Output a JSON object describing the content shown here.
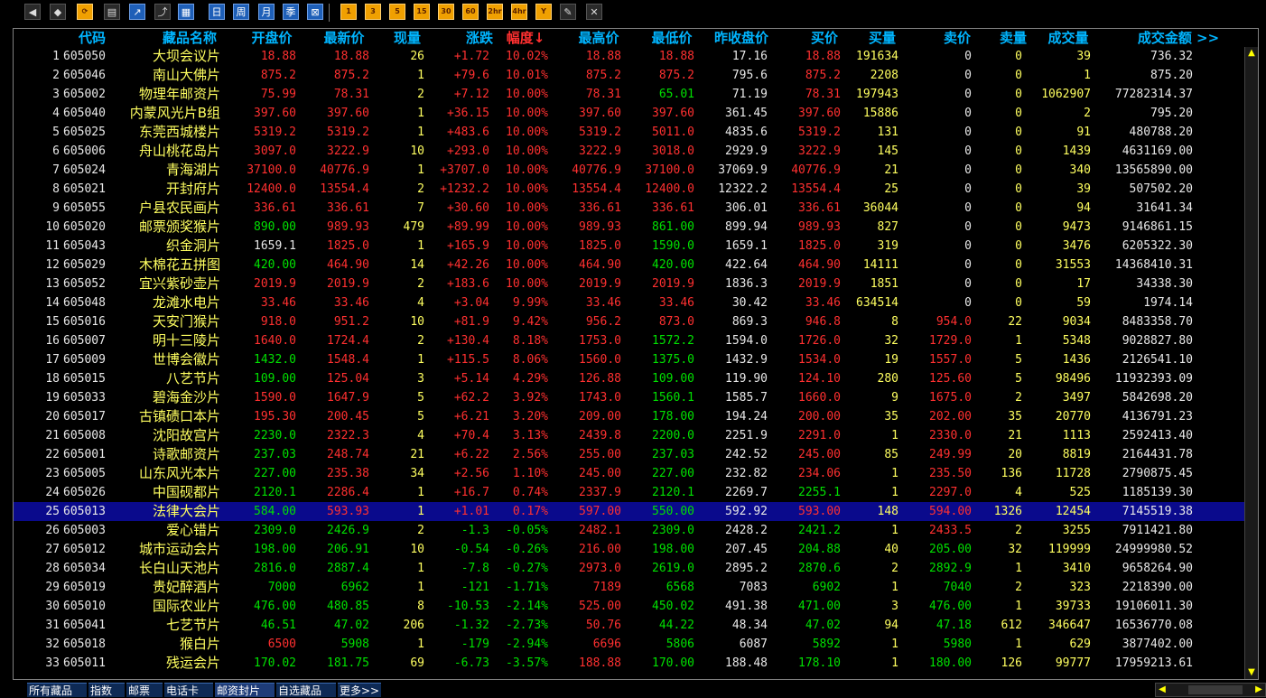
{
  "toolbar": {
    "buttons": [
      {
        "name": "back-icon",
        "glyph": "◀",
        "kind": "misc"
      },
      {
        "name": "box-icon",
        "glyph": "◆",
        "kind": "misc"
      },
      {
        "name": "refresh-icon",
        "glyph": "⟳",
        "kind": "orange"
      },
      {
        "name": "clipboard-icon",
        "glyph": "▤",
        "kind": "misc"
      },
      {
        "name": "line-chart-icon",
        "glyph": "↗",
        "kind": "blue"
      },
      {
        "name": "trend-chart-icon",
        "glyph": "⤴",
        "kind": "misc"
      },
      {
        "name": "table-icon",
        "glyph": "▦",
        "kind": "blue"
      },
      {
        "name": "day-button",
        "glyph": "日",
        "kind": "blue"
      },
      {
        "name": "week-button",
        "glyph": "周",
        "kind": "blue"
      },
      {
        "name": "month-button",
        "glyph": "月",
        "kind": "blue"
      },
      {
        "name": "quarter-button",
        "glyph": "季",
        "kind": "blue"
      },
      {
        "name": "crosshair-icon",
        "glyph": "⊠",
        "kind": "blue"
      },
      {
        "name": "period-1-button",
        "glyph": "1",
        "kind": "orange"
      },
      {
        "name": "period-3-button",
        "glyph": "3",
        "kind": "orange"
      },
      {
        "name": "period-5-button",
        "glyph": "5",
        "kind": "orange"
      },
      {
        "name": "period-15-button",
        "glyph": "15",
        "kind": "orange"
      },
      {
        "name": "period-30-button",
        "glyph": "30",
        "kind": "orange"
      },
      {
        "name": "period-60-button",
        "glyph": "60",
        "kind": "orange"
      },
      {
        "name": "period-2hr-button",
        "glyph": "2hr",
        "kind": "orange"
      },
      {
        "name": "period-4hr-button",
        "glyph": "4hr",
        "kind": "orange"
      },
      {
        "name": "year-button",
        "glyph": "Y",
        "kind": "orange"
      },
      {
        "name": "pencil-icon",
        "glyph": "✎",
        "kind": "misc"
      },
      {
        "name": "tools-icon",
        "glyph": "✕",
        "kind": "misc"
      }
    ]
  },
  "columns": [
    "代码",
    "藏品名称",
    "开盘价",
    "最新价",
    "现量",
    "涨跌",
    "幅度↓",
    "最高价",
    "最低价",
    "昨收盘价",
    "买价",
    "买量",
    "卖价",
    "卖量",
    "成交量",
    "成交金额 >>"
  ],
  "rows": [
    [
      "1",
      "605050",
      "大坝会议片",
      "18.88",
      "18.88",
      "26",
      "+1.72",
      "10.02%",
      "18.88",
      "18.88",
      "17.16",
      "18.88",
      "191634",
      "0",
      "0",
      "39",
      "736.32"
    ],
    [
      "2",
      "605046",
      "南山大佛片",
      "875.2",
      "875.2",
      "1",
      "+79.6",
      "10.01%",
      "875.2",
      "875.2",
      "795.6",
      "875.2",
      "2208",
      "0",
      "0",
      "1",
      "875.20"
    ],
    [
      "3",
      "605002",
      "物理年邮资片",
      "75.99",
      "78.31",
      "2",
      "+7.12",
      "10.00%",
      "78.31",
      "65.01",
      "71.19",
      "78.31",
      "197943",
      "0",
      "0",
      "1062907",
      "77282314.37"
    ],
    [
      "4",
      "605040",
      "内蒙风光片B组",
      "397.60",
      "397.60",
      "1",
      "+36.15",
      "10.00%",
      "397.60",
      "397.60",
      "361.45",
      "397.60",
      "15886",
      "0",
      "0",
      "2",
      "795.20"
    ],
    [
      "5",
      "605025",
      "东莞西城楼片",
      "5319.2",
      "5319.2",
      "1",
      "+483.6",
      "10.00%",
      "5319.2",
      "5011.0",
      "4835.6",
      "5319.2",
      "131",
      "0",
      "0",
      "91",
      "480788.20"
    ],
    [
      "6",
      "605006",
      "舟山桃花岛片",
      "3097.0",
      "3222.9",
      "10",
      "+293.0",
      "10.00%",
      "3222.9",
      "3018.0",
      "2929.9",
      "3222.9",
      "145",
      "0",
      "0",
      "1439",
      "4631169.00"
    ],
    [
      "7",
      "605024",
      "青海湖片",
      "37100.0",
      "40776.9",
      "1",
      "+3707.0",
      "10.00%",
      "40776.9",
      "37100.0",
      "37069.9",
      "40776.9",
      "21",
      "0",
      "0",
      "340",
      "13565890.00"
    ],
    [
      "8",
      "605021",
      "开封府片",
      "12400.0",
      "13554.4",
      "2",
      "+1232.2",
      "10.00%",
      "13554.4",
      "12400.0",
      "12322.2",
      "13554.4",
      "25",
      "0",
      "0",
      "39",
      "507502.20"
    ],
    [
      "9",
      "605055",
      "户县农民画片",
      "336.61",
      "336.61",
      "7",
      "+30.60",
      "10.00%",
      "336.61",
      "336.61",
      "306.01",
      "336.61",
      "36044",
      "0",
      "0",
      "94",
      "31641.34"
    ],
    [
      "10",
      "605020",
      "邮票颁奖猴片",
      "890.00",
      "989.93",
      "479",
      "+89.99",
      "10.00%",
      "989.93",
      "861.00",
      "899.94",
      "989.93",
      "827",
      "0",
      "0",
      "9473",
      "9146861.15"
    ],
    [
      "11",
      "605043",
      "织金洞片",
      "1659.1",
      "1825.0",
      "1",
      "+165.9",
      "10.00%",
      "1825.0",
      "1590.0",
      "1659.1",
      "1825.0",
      "319",
      "0",
      "0",
      "3476",
      "6205322.30"
    ],
    [
      "12",
      "605029",
      "木棉花五拼图",
      "420.00",
      "464.90",
      "14",
      "+42.26",
      "10.00%",
      "464.90",
      "420.00",
      "422.64",
      "464.90",
      "14111",
      "0",
      "0",
      "31553",
      "14368410.31"
    ],
    [
      "13",
      "605052",
      "宜兴紫砂壶片",
      "2019.9",
      "2019.9",
      "2",
      "+183.6",
      "10.00%",
      "2019.9",
      "2019.9",
      "1836.3",
      "2019.9",
      "1851",
      "0",
      "0",
      "17",
      "34338.30"
    ],
    [
      "14",
      "605048",
      "龙滩水电片",
      "33.46",
      "33.46",
      "4",
      "+3.04",
      "9.99%",
      "33.46",
      "33.46",
      "30.42",
      "33.46",
      "634514",
      "0",
      "0",
      "59",
      "1974.14"
    ],
    [
      "15",
      "605016",
      "天安门猴片",
      "918.0",
      "951.2",
      "10",
      "+81.9",
      "9.42%",
      "956.2",
      "873.0",
      "869.3",
      "946.8",
      "8",
      "954.0",
      "22",
      "9034",
      "8483358.70"
    ],
    [
      "16",
      "605007",
      "明十三陵片",
      "1640.0",
      "1724.4",
      "2",
      "+130.4",
      "8.18%",
      "1753.0",
      "1572.2",
      "1594.0",
      "1726.0",
      "32",
      "1729.0",
      "1",
      "5348",
      "9028827.80"
    ],
    [
      "17",
      "605009",
      "世博会徽片",
      "1432.0",
      "1548.4",
      "1",
      "+115.5",
      "8.06%",
      "1560.0",
      "1375.0",
      "1432.9",
      "1534.0",
      "19",
      "1557.0",
      "5",
      "1436",
      "2126541.10"
    ],
    [
      "18",
      "605015",
      "八艺节片",
      "109.00",
      "125.04",
      "3",
      "+5.14",
      "4.29%",
      "126.88",
      "109.00",
      "119.90",
      "124.10",
      "280",
      "125.60",
      "5",
      "98496",
      "11932393.09"
    ],
    [
      "19",
      "605033",
      "碧海金沙片",
      "1590.0",
      "1647.9",
      "5",
      "+62.2",
      "3.92%",
      "1743.0",
      "1560.1",
      "1585.7",
      "1660.0",
      "9",
      "1675.0",
      "2",
      "3497",
      "5842698.20"
    ],
    [
      "20",
      "605017",
      "古镇碛口本片",
      "195.30",
      "200.45",
      "5",
      "+6.21",
      "3.20%",
      "209.00",
      "178.00",
      "194.24",
      "200.00",
      "35",
      "202.00",
      "35",
      "20770",
      "4136791.23"
    ],
    [
      "21",
      "605008",
      "沈阳故宫片",
      "2230.0",
      "2322.3",
      "4",
      "+70.4",
      "3.13%",
      "2439.8",
      "2200.0",
      "2251.9",
      "2291.0",
      "1",
      "2330.0",
      "21",
      "1113",
      "2592413.40"
    ],
    [
      "22",
      "605001",
      "诗歌邮资片",
      "237.03",
      "248.74",
      "21",
      "+6.22",
      "2.56%",
      "255.00",
      "237.03",
      "242.52",
      "245.00",
      "85",
      "249.99",
      "20",
      "8819",
      "2164431.78"
    ],
    [
      "23",
      "605005",
      "山东风光本片",
      "227.00",
      "235.38",
      "34",
      "+2.56",
      "1.10%",
      "245.00",
      "227.00",
      "232.82",
      "234.06",
      "1",
      "235.50",
      "136",
      "11728",
      "2790875.45"
    ],
    [
      "24",
      "605026",
      "中国砚都片",
      "2120.1",
      "2286.4",
      "1",
      "+16.7",
      "0.74%",
      "2337.9",
      "2120.1",
      "2269.7",
      "2255.1",
      "1",
      "2297.0",
      "4",
      "525",
      "1185139.30"
    ],
    [
      "25",
      "605013",
      "法律大会片",
      "584.00",
      "593.93",
      "1",
      "+1.01",
      "0.17%",
      "597.00",
      "550.00",
      "592.92",
      "593.00",
      "148",
      "594.00",
      "1326",
      "12454",
      "7145519.38"
    ],
    [
      "26",
      "605003",
      "爱心错片",
      "2309.0",
      "2426.9",
      "2",
      "-1.3",
      "-0.05%",
      "2482.1",
      "2309.0",
      "2428.2",
      "2421.2",
      "1",
      "2433.5",
      "2",
      "3255",
      "7911421.80"
    ],
    [
      "27",
      "605012",
      "城市运动会片",
      "198.00",
      "206.91",
      "10",
      "-0.54",
      "-0.26%",
      "216.00",
      "198.00",
      "207.45",
      "204.88",
      "40",
      "205.00",
      "32",
      "119999",
      "24999980.52"
    ],
    [
      "28",
      "605034",
      "长白山天池片",
      "2816.0",
      "2887.4",
      "1",
      "-7.8",
      "-0.27%",
      "2973.0",
      "2619.0",
      "2895.2",
      "2870.6",
      "2",
      "2892.9",
      "1",
      "3410",
      "9658264.90"
    ],
    [
      "29",
      "605019",
      "贵妃醉酒片",
      "7000",
      "6962",
      "1",
      "-121",
      "-1.71%",
      "7189",
      "6568",
      "7083",
      "6902",
      "1",
      "7040",
      "2",
      "323",
      "2218390.00"
    ],
    [
      "30",
      "605010",
      "国际农业片",
      "476.00",
      "480.85",
      "8",
      "-10.53",
      "-2.14%",
      "525.00",
      "450.02",
      "491.38",
      "471.00",
      "3",
      "476.00",
      "1",
      "39733",
      "19106011.30"
    ],
    [
      "31",
      "605041",
      "七艺节片",
      "46.51",
      "47.02",
      "206",
      "-1.32",
      "-2.73%",
      "50.76",
      "44.22",
      "48.34",
      "47.02",
      "94",
      "47.18",
      "612",
      "346647",
      "16536770.08"
    ],
    [
      "32",
      "605018",
      "猴白片",
      "6500",
      "5908",
      "1",
      "-179",
      "-2.94%",
      "6696",
      "5806",
      "6087",
      "5892",
      "1",
      "5980",
      "1",
      "629",
      "3877402.00"
    ],
    [
      "33",
      "605011",
      "残运会片",
      "170.02",
      "181.75",
      "69",
      "-6.73",
      "-3.57%",
      "188.88",
      "170.00",
      "188.48",
      "178.10",
      "1",
      "180.00",
      "126",
      "99777",
      "17959213.61"
    ]
  ],
  "selected_row": 24,
  "tabs": [
    "所有藏品",
    "指数",
    "邮票",
    "电话卡",
    "邮资封片",
    "自选藏品",
    "更多>>"
  ],
  "active_tab": 4,
  "colors": {
    "up": "#ff3030",
    "down": "#00e000",
    "flat": "#e8e8e8",
    "name": "#ffff60",
    "header": "#00b5ff",
    "selected": "#0a0a8c"
  }
}
